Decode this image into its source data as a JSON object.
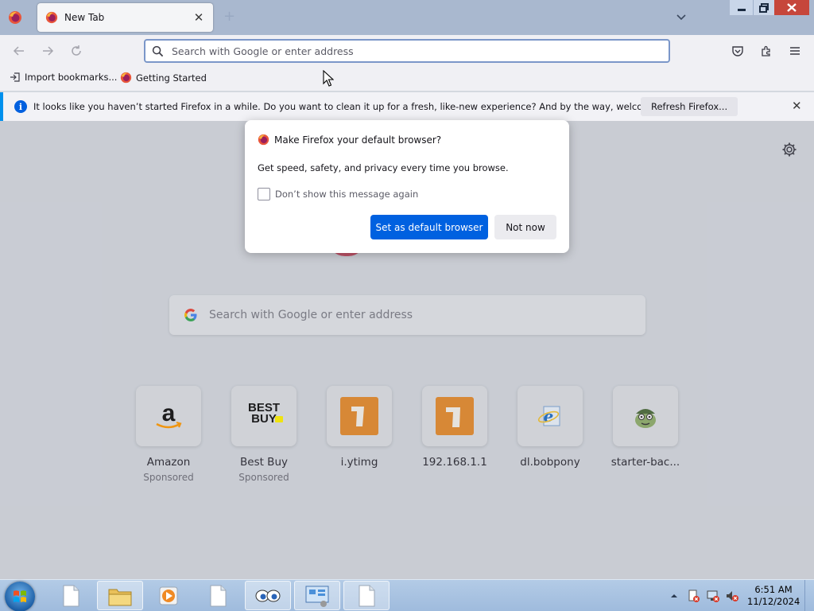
{
  "browser": {
    "tab": {
      "title": "New Tab"
    },
    "urlbar": {
      "placeholder": "Search with Google or enter address"
    }
  },
  "bookmarks": [
    {
      "label": "Import bookmarks...",
      "icon": "import-icon"
    },
    {
      "label": "Getting Started",
      "icon": "firefox-icon"
    }
  ],
  "notification": {
    "message": "It looks like you haven’t started Firefox in a while. Do you want to clean it up for a fresh, like-new experience? And by the way, welcome back!",
    "button": "Refresh Firefox..."
  },
  "newtab": {
    "search_placeholder": "Search with Google or enter address",
    "tiles": [
      {
        "name": "Amazon",
        "sponsored": "Sponsored",
        "icon": "amazon-icon"
      },
      {
        "name": "Best Buy",
        "sponsored": "Sponsored",
        "icon": "bestbuy-icon"
      },
      {
        "name": "i.ytimg",
        "sponsored": "",
        "icon": "letter-i-icon"
      },
      {
        "name": "192.168.1.1",
        "sponsored": "",
        "icon": "number-1-icon"
      },
      {
        "name": "dl.bobpony",
        "sponsored": "",
        "icon": "ie-icon"
      },
      {
        "name": "starter-bac...",
        "sponsored": "",
        "icon": "character-icon"
      }
    ],
    "bestbuy_logo": [
      "BEST",
      "BUY"
    ]
  },
  "modal": {
    "title": "Make Firefox your default browser?",
    "body": "Get speed, safety, and privacy every time you browse.",
    "checkbox_label": "Don’t show this message again",
    "checkbox_checked": false,
    "primary_button": "Set as default browser",
    "secondary_button": "Not now"
  },
  "taskbar": {
    "time": "6:51 AM",
    "date": "11/12/2024",
    "items": [
      "document-icon",
      "file-explorer-icon",
      "media-player-icon",
      "document-icon",
      "eyes-icon",
      "control-panel-icon",
      "document-icon"
    ],
    "active_index": 6
  },
  "colors": {
    "accent": "#0061e0",
    "notification_border": "#0090ed",
    "close_button": "#c6463b"
  }
}
